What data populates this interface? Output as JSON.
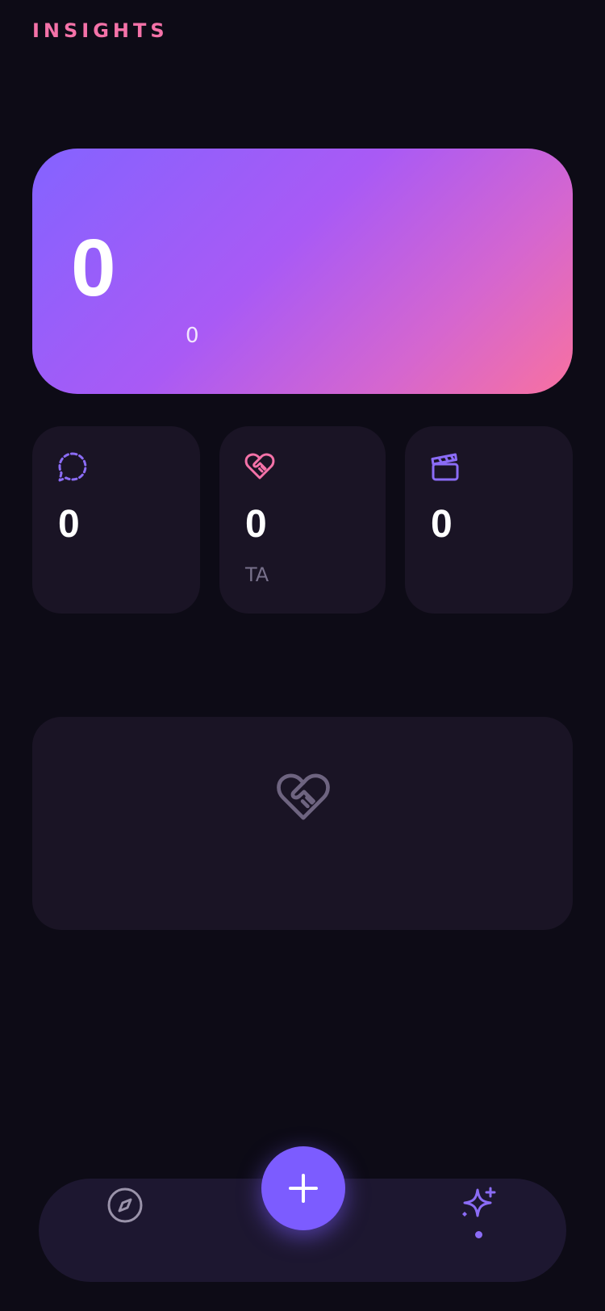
{
  "header": {
    "title": "INSIGHTS"
  },
  "hero": {
    "value": "0",
    "sub_value": "0",
    "gradient_colors": [
      "#8463ff",
      "#a95af5",
      "#f871a0"
    ]
  },
  "stats": [
    {
      "icon": "chat-bubble-dashed-icon",
      "value": "0",
      "sub": ""
    },
    {
      "icon": "heart-handshake-icon",
      "value": "0",
      "sub": "TA"
    },
    {
      "icon": "clapperboard-icon",
      "value": "0",
      "sub": ""
    }
  ],
  "empty_state": {
    "icon": "heart-handshake-icon"
  },
  "nav": {
    "items": [
      {
        "icon": "compass-icon",
        "active": false
      },
      {
        "icon": "plus-icon",
        "active": false
      },
      {
        "icon": "sparkles-icon",
        "active": true
      }
    ]
  },
  "colors": {
    "background": "#0d0b16",
    "card": "#1a1425",
    "accent_pink": "#f472a8",
    "accent_purple": "#8b6cf6",
    "fab": "#7c5cff"
  }
}
